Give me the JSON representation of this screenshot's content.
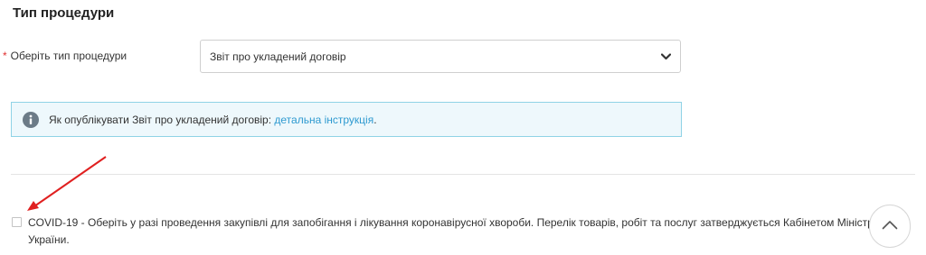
{
  "section": {
    "title": "Тип процедури"
  },
  "procedure_field": {
    "required_mark": "*",
    "label": "Оберіть тип процедури",
    "selected_value": "Звіт про укладений договір",
    "chevron_icon": "chevron-down-icon"
  },
  "info": {
    "icon": "info-icon",
    "text": "Як опублікувати Звіт про укладений договір:",
    "link_text": "детальна інструкція",
    "trailing": "."
  },
  "covid": {
    "line1": "COVID-19 - Оберіть у разі проведення закупівлі для запобігання і лікування коронавірусної хвороби. Перелік товарів, робіт та послуг затверджується Кабінетом Міністрів",
    "line2": "України.",
    "checked": false
  },
  "scroll_top": {
    "icon": "chevron-up-icon"
  },
  "colors": {
    "required": "#e03030",
    "link": "#2e9ad0",
    "info_border": "#8fd3e6",
    "info_bg": "#eef8fc",
    "annotation_arrow": "#e02020"
  }
}
